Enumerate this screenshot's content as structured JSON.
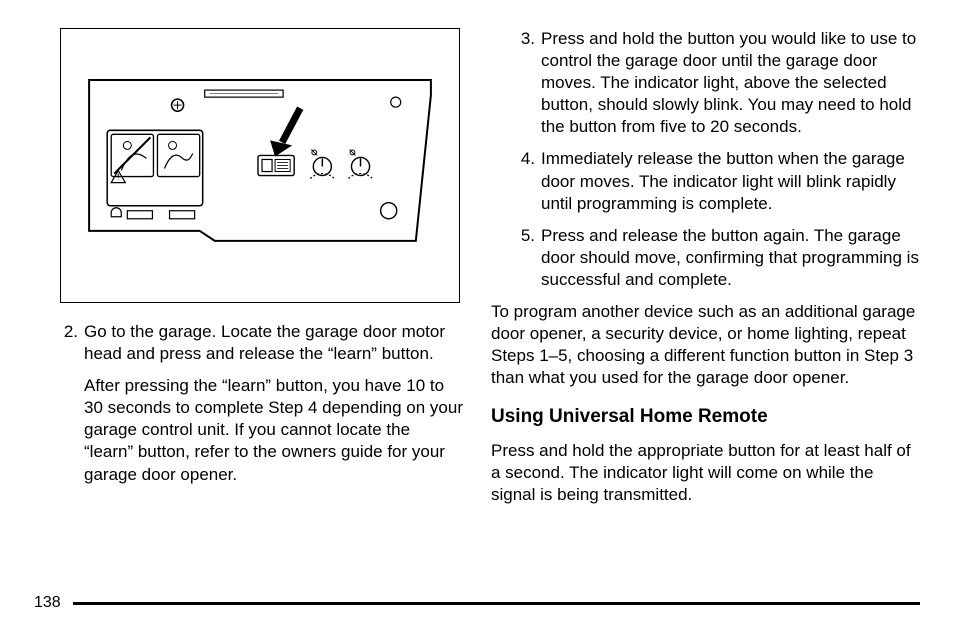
{
  "left": {
    "step2": {
      "num": "2.",
      "text": "Go to the garage. Locate the garage door motor head and press and release the “learn” button.",
      "sub": "After pressing the “learn” button, you have 10 to 30 seconds to complete Step 4 depending on your garage control unit. If you cannot locate the “learn” button, refer to the owners guide for your garage door opener."
    }
  },
  "right": {
    "step3": {
      "num": "3.",
      "text": "Press and hold the button you would like to use to control the garage door until the garage door moves. The indicator light, above the selected button, should slowly blink. You may need to hold the button from five to 20 seconds."
    },
    "step4": {
      "num": "4.",
      "text": "Immediately release the button when the garage door moves. The indicator light will blink rapidly until programming is complete."
    },
    "step5": {
      "num": "5.",
      "text": "Press and release the button again. The garage door should move, confirming that programming is successful and complete."
    },
    "closing": "To program another device such as an additional garage door opener, a security device, or home lighting, repeat Steps 1–5, choosing a different function button in Step 3 than what you used for the garage door opener.",
    "heading": "Using Universal Home Remote",
    "usage": "Press and hold the appropriate button for at least half of a second. The indicator light will come on while the signal is being transmitted."
  },
  "page_number": "138"
}
